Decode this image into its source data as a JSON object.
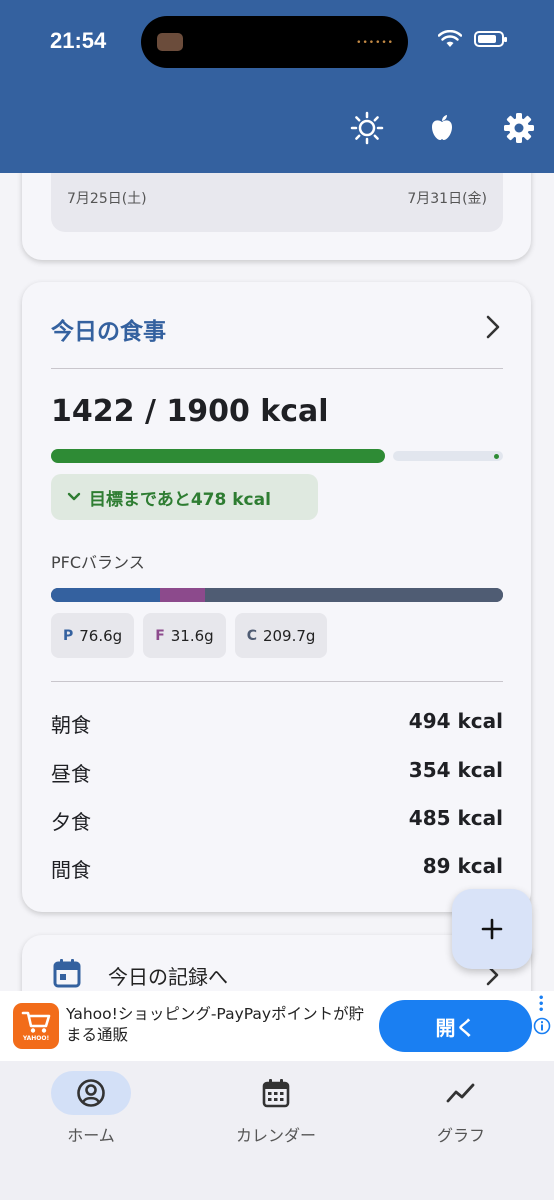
{
  "status_bar": {
    "time": "21:54"
  },
  "app_bar": {
    "icons": [
      "brightness-icon",
      "apple-icon",
      "settings-icon"
    ]
  },
  "week": {
    "start_date": "7月25日(土)",
    "end_date": "7月31日(金)"
  },
  "meals_card": {
    "title": "今日の食事",
    "total_text": "1422 / 1900 kcal",
    "progress_fraction": 0.7484,
    "goal_text": "目標まであと478 kcal",
    "pfc_label": "PFCバランス",
    "pfc": [
      {
        "letter": "P",
        "value": "76.6g",
        "color": "#34619f"
      },
      {
        "letter": "F",
        "value": "31.6g",
        "color": "#8c4a8c"
      },
      {
        "letter": "C",
        "value": "209.7g",
        "color": "#4f5c73"
      }
    ],
    "rows": [
      {
        "name": "朝食",
        "kcal": "494 kcal"
      },
      {
        "name": "昼食",
        "kcal": "354 kcal"
      },
      {
        "name": "夕食",
        "kcal": "485 kcal"
      },
      {
        "name": "間食",
        "kcal": "89 kcal"
      }
    ]
  },
  "record_card": {
    "label": "今日の記録へ"
  },
  "fab": {
    "icon": "add-icon"
  },
  "ad": {
    "text": "Yahoo!ショッピング-PayPayポイントが貯まる通販",
    "logo_text": "YAHOO!",
    "button_label": "開く"
  },
  "bottom_nav": {
    "items": [
      {
        "label": "ホーム",
        "icon": "account-circle-icon",
        "active": true
      },
      {
        "label": "カレンダー",
        "icon": "calendar-icon",
        "active": false
      },
      {
        "label": "グラフ",
        "icon": "chart-line-icon",
        "active": false
      }
    ]
  },
  "colors": {
    "primary": "#34619f",
    "progress_green": "#2e8b35",
    "ad_blue": "#1a7ff2"
  }
}
